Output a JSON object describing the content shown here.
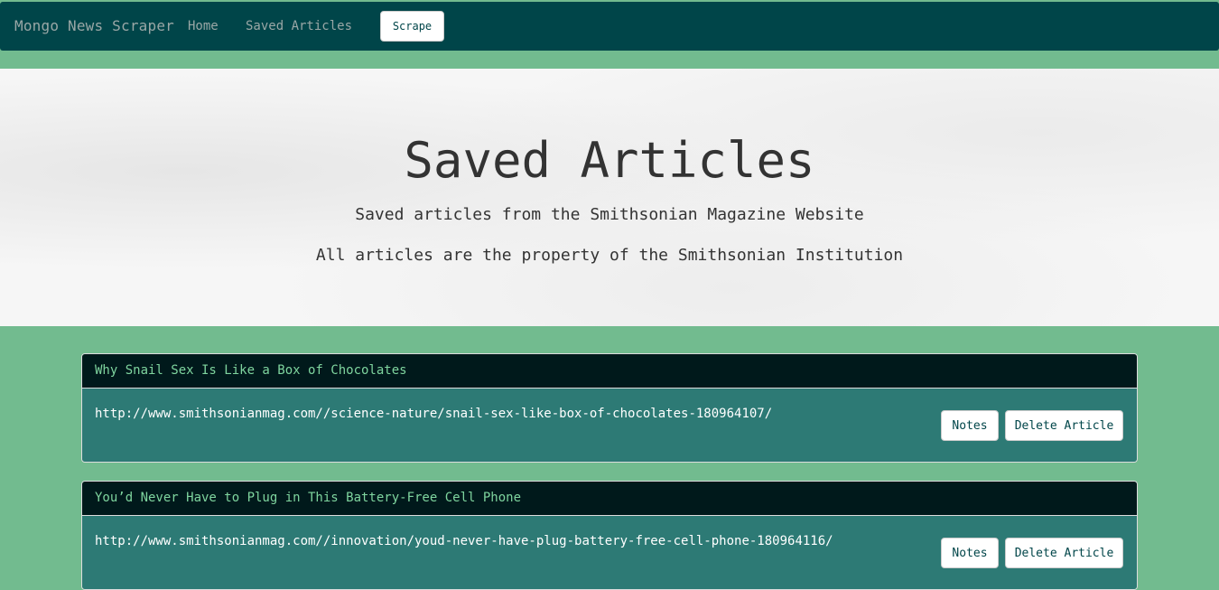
{
  "navbar": {
    "brand": "Mongo News Scraper",
    "home_label": "Home",
    "saved_label": "Saved Articles",
    "scrape_label": "Scrape"
  },
  "jumbotron": {
    "title": "Saved Articles",
    "subtitle_1": "Saved articles from the Smithsonian Magazine Website",
    "subtitle_2": "All articles are the property of the Smithsonian Institution"
  },
  "articles": [
    {
      "title": "Why Snail Sex Is Like a Box of Chocolates",
      "link": "http://www.smithsonianmag.com//science-nature/snail-sex-like-box-of-chocolates-180964107/",
      "notes_label": "Notes",
      "delete_label": "Delete Article"
    },
    {
      "title": "You’d Never Have to Plug in This Battery-Free Cell Phone",
      "link": "http://www.smithsonianmag.com//innovation/youd-never-have-plug-battery-free-cell-phone-180964116/",
      "notes_label": "Notes",
      "delete_label": "Delete Article"
    }
  ],
  "colors": {
    "navbar_bg": "#004549",
    "page_bg": "#72bb8f",
    "card_header_bg": "#00191b",
    "card_body_bg": "#2d7a75",
    "card_title": "#7fd59f"
  }
}
